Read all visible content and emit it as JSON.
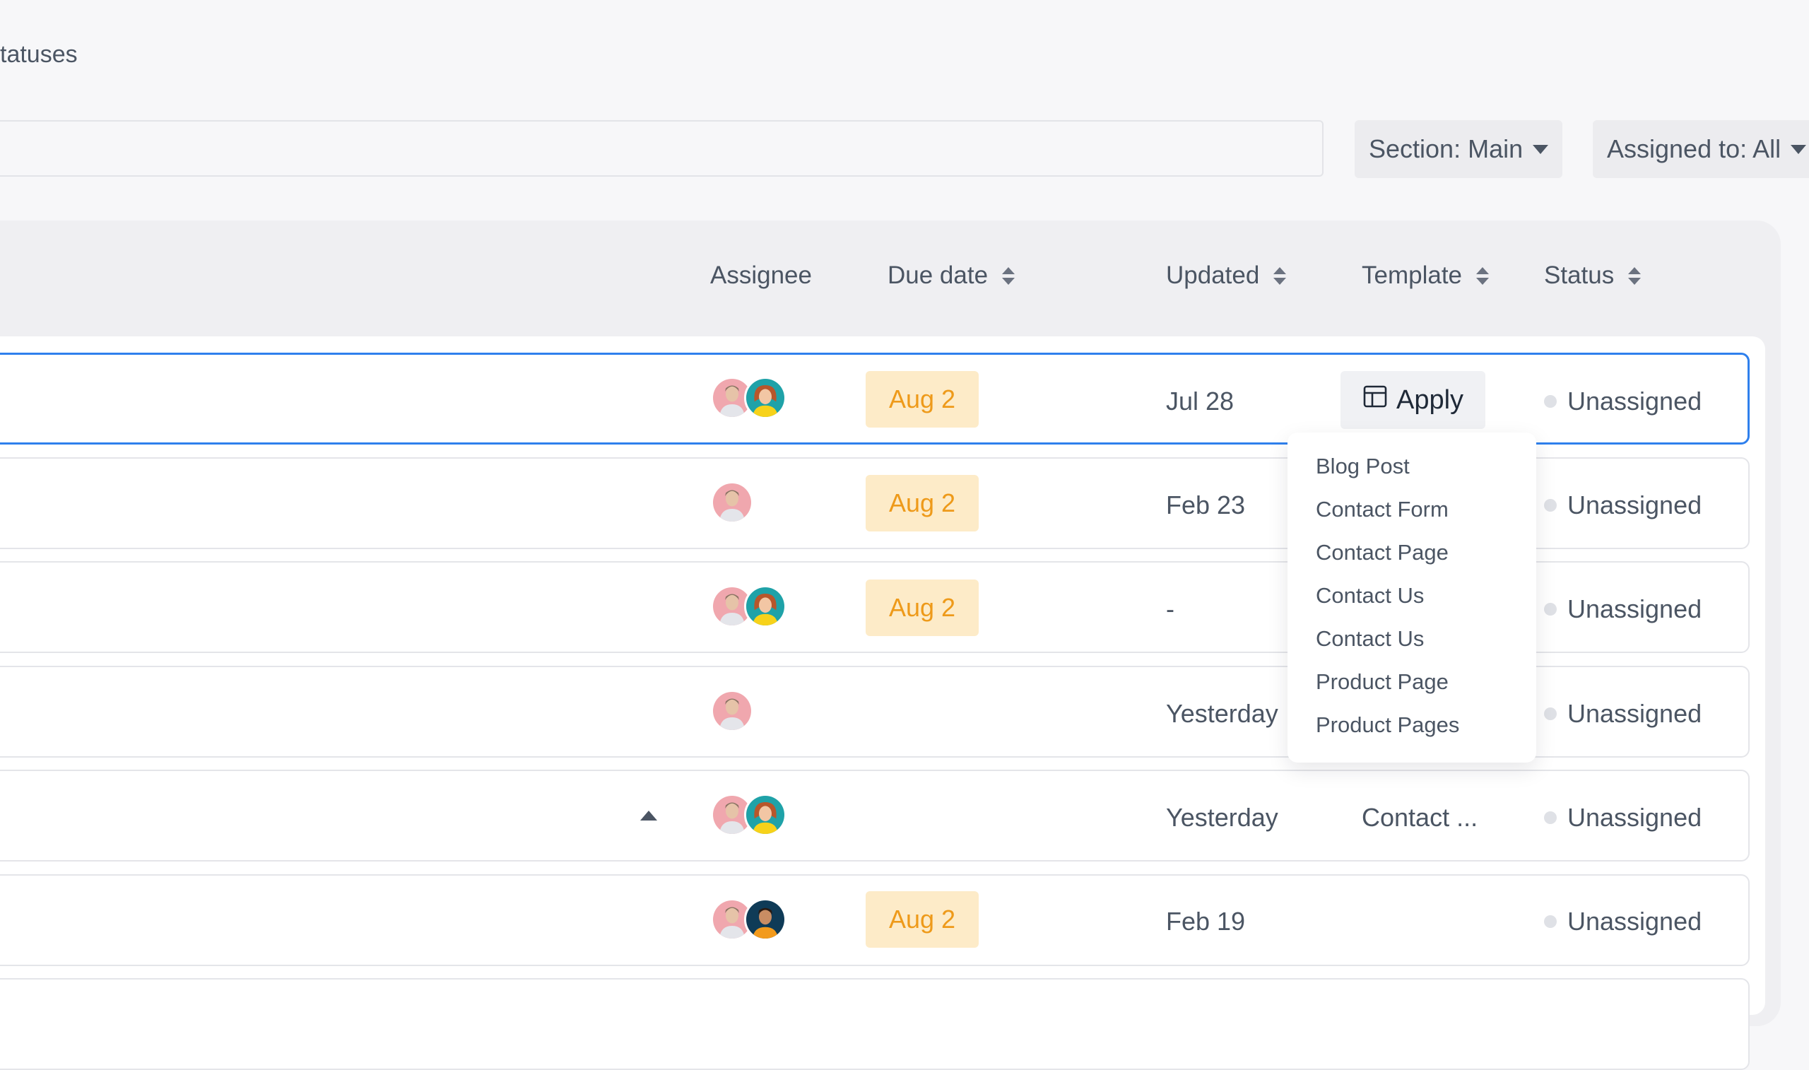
{
  "page": {
    "heading": "tatuses"
  },
  "filters": {
    "section": "Section: Main",
    "assigned": "Assigned to: All"
  },
  "columns": {
    "assignee": "Assignee",
    "due_date": "Due date",
    "updated": "Updated",
    "template": "Template",
    "status": "Status"
  },
  "rows": [
    {
      "due": "Aug 2",
      "updated": "Jul 28",
      "template": "",
      "status": "Unassigned",
      "assignees": [
        "user-man-avatar",
        "user-woman-avatar"
      ]
    },
    {
      "due": "Aug 2",
      "updated": "Feb 23",
      "template": "",
      "status": "Unassigned",
      "assignees": [
        "user-man-avatar"
      ]
    },
    {
      "due": "Aug 2",
      "updated": "-",
      "template": "",
      "status": "Unassigned",
      "assignees": [
        "user-man-avatar",
        "user-woman-avatar"
      ]
    },
    {
      "due": "",
      "updated": "Yesterday",
      "template": "",
      "status": "Unassigned",
      "assignees": [
        "user-man-avatar"
      ]
    },
    {
      "due": "",
      "updated": "Yesterday",
      "template": "Contact ...",
      "status": "Unassigned",
      "assignees": [
        "user-man-avatar",
        "user-woman-avatar"
      ]
    },
    {
      "due": "Aug 2",
      "updated": "Feb 19",
      "template": "",
      "status": "Unassigned",
      "assignees": [
        "user-man-avatar",
        "user-man-dark-avatar"
      ]
    }
  ],
  "apply_button": {
    "label": "Apply",
    "icon": "template-icon"
  },
  "template_dropdown": {
    "options": [
      "Blog Post",
      "Contact Form",
      "Contact Page",
      "Contact Us",
      "Contact Us",
      "Product Page",
      "Product Pages"
    ]
  },
  "colors": {
    "accent": "#2f80ed",
    "due_badge_bg": "#fdebc8",
    "due_badge_text": "#ee9a1a",
    "status_dot": "#dfe1e6"
  }
}
